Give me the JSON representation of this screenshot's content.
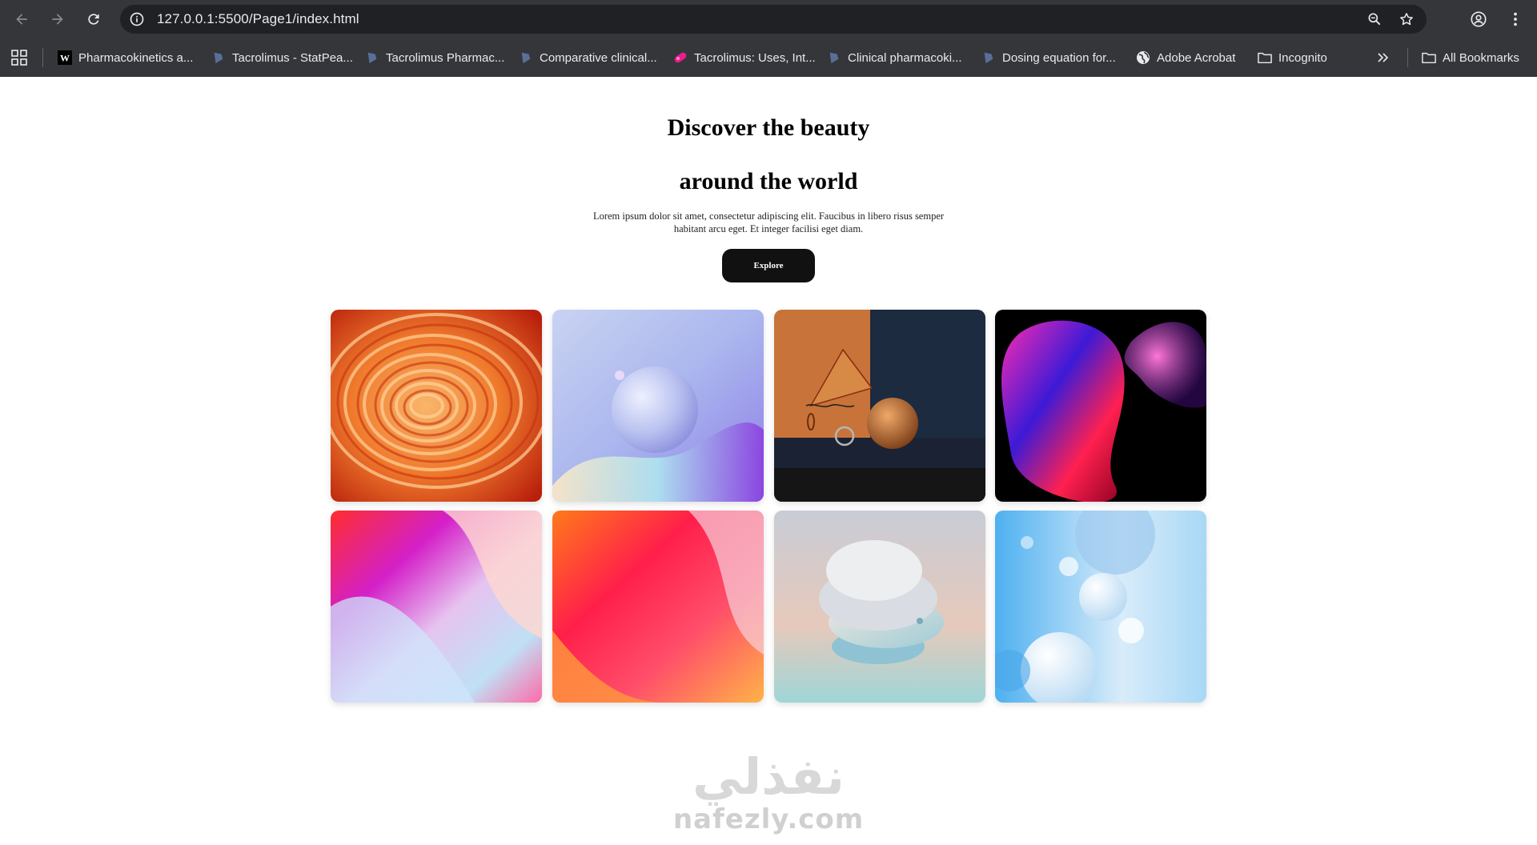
{
  "browser": {
    "url": "127.0.0.1:5500/Page1/index.html",
    "bookmarks": [
      {
        "label": "Pharmacokinetics a...",
        "icon": "w-logo-icon"
      },
      {
        "label": "Tacrolimus - StatPea...",
        "icon": "page-icon"
      },
      {
        "label": "Tacrolimus Pharmac...",
        "icon": "page-icon"
      },
      {
        "label": "Comparative clinical...",
        "icon": "page-icon"
      },
      {
        "label": "Tacrolimus: Uses, Int...",
        "icon": "pill-icon"
      },
      {
        "label": "Clinical pharmacoki...",
        "icon": "page-icon"
      },
      {
        "label": "Dosing equation for...",
        "icon": "page-icon"
      },
      {
        "label": "Adobe Acrobat",
        "icon": "globe-icon"
      },
      {
        "label": "Incognito",
        "icon": "folder-icon"
      }
    ],
    "all_bookmarks": "All Bookmarks"
  },
  "hero": {
    "title_line1": "Discover the beauty",
    "title_line2": "around the world",
    "description": "Lorem ipsum dolor sit amet, consectetur adipiscing elit. Faucibus in libero risus semper habitant arcu eget. Et integer facilisi eget diam.",
    "button": "Explore"
  },
  "gallery": [
    "orange-swirl-artwork",
    "pastel-sphere-artwork",
    "sphere-and-cone-scene",
    "neon-blob-artwork",
    "pink-purple-gradient",
    "red-orange-gradient",
    "stacked-discs-artwork",
    "blue-bubbles-artwork"
  ],
  "watermark": {
    "arabic": "نفذلي",
    "latin": "nafezly.com"
  },
  "colors": {
    "chrome": "#35363a",
    "omnibox": "#202124",
    "button": "#111111"
  }
}
